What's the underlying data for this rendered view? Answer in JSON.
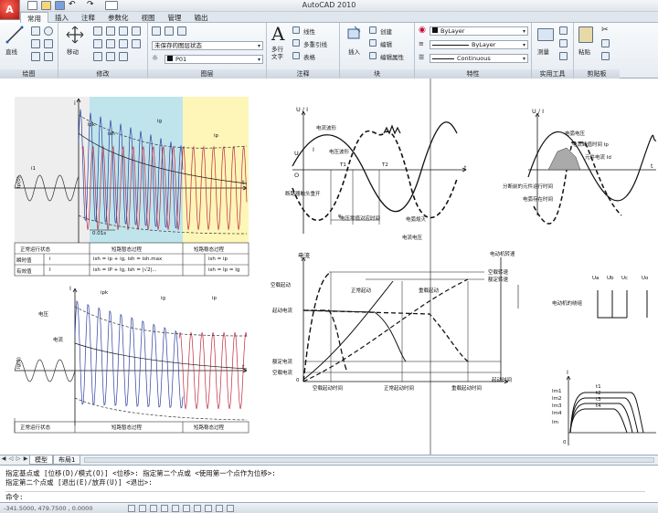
{
  "app": {
    "title": "AutoCAD 2010",
    "logo_letter": "A"
  },
  "quick_access": {
    "icons": [
      "new-file-icon",
      "open-folder-icon",
      "save-icon",
      "undo-icon",
      "redo-icon",
      "plot-icon"
    ]
  },
  "tabs": [
    "常用",
    "插入",
    "注释",
    "参数化",
    "视图",
    "管理",
    "输出"
  ],
  "ribbon": {
    "draw": {
      "title": "绘图",
      "line_label": "直线"
    },
    "modify": {
      "title": "修改",
      "move_label": "移动"
    },
    "layers": {
      "title": "图层",
      "layer_state": "未保存的图层状态",
      "current_layer": "P01"
    },
    "annotation": {
      "title": "注释",
      "text_label": "多行\n文字",
      "linear_label": "线性",
      "mleader_label": "多重引线",
      "table_label": "表格"
    },
    "block": {
      "title": "块",
      "insert_label": "插入",
      "create_label": "创建",
      "edit_label": "编辑",
      "edit_attr_label": "编辑属性"
    },
    "properties": {
      "title": "特性",
      "color": "ByLayer",
      "linetype": "ByLayer",
      "lineweight": "Continuous"
    },
    "utilities": {
      "title": "实用工具",
      "measure_label": "测量"
    },
    "clipboard": {
      "title": "剪贴板",
      "paste_label": "粘贴"
    }
  },
  "drawing": {
    "fig1": {
      "i_axis": "i",
      "t_axis": "t",
      "ipk": "ipk",
      "ish": "ish",
      "ig": "ig",
      "ip": "ip",
      "i1": "i1",
      "ip_pk": "Ip(0)",
      "table_rows": [
        [
          "正常运行状态",
          "",
          "短路暂态过程",
          "短路稳态过程"
        ],
        [
          "瞬时值",
          "i",
          "ish = ip + ig,  ish = ish.max",
          "ish = ip"
        ],
        [
          "有效值",
          "I",
          "ish = IP + Ig,  Ish = |√2|...",
          "ish = Ip = Ig"
        ]
      ],
      "time_label": "0.01s"
    },
    "fig2": {
      "u_axis": "U / I",
      "t_axis": "t",
      "U": "U",
      "I": "I",
      "O": "O",
      "T1": "T1",
      "T2": "T2",
      "phi": "φ",
      "labels": [
        "电流波形",
        "电压波形",
        "断路器触头重开",
        "电压零值对应时间",
        "电弧熄灭",
        "电流电压"
      ]
    },
    "fig3": {
      "u_axis": "U / I",
      "t_axis": "t",
      "labels": [
        "电弧电压",
        "电流峰值时间 Ip",
        "元件电流 Id",
        "分断前的元件运行时间",
        "电弧存在时间"
      ]
    },
    "fig4": {
      "i_axis": "I",
      "t_axis": "t",
      "ipk": "ipk",
      "ig": "ig",
      "ip": "ip",
      "voltage": "电压",
      "current": "电流",
      "ig0": "Ig(0)",
      "table": [
        "正常运行状态",
        "短路暂态过程",
        "短路稳态过程"
      ]
    },
    "fig5": {
      "y_title": "电流",
      "speed_title": "电动机转速",
      "curves": [
        "空载转速",
        "额定转速",
        "空载起动",
        "正常起动",
        "重载起动",
        "起动电流",
        "额定电流",
        "空载电流"
      ],
      "x_labels": [
        "空载起动时间",
        "正常起动时间",
        "重载起动时间"
      ],
      "x_axis": "起动时间",
      "origin": "0"
    },
    "fig6": {
      "phases": [
        "Ua",
        "Ub",
        "Uc",
        "Uo"
      ],
      "label": "电动机的绕组"
    },
    "fig7": {
      "y_axis": "I",
      "y_levels": [
        "Im1",
        "Im2",
        "Im3",
        "Im4",
        "Im"
      ],
      "curves": [
        "t1",
        "t2",
        "t3",
        "t4"
      ],
      "origin": "0"
    }
  },
  "layout_tabs": [
    "模型",
    "布局1"
  ],
  "command": {
    "history": [
      "指定基点或 [位移(D)/模式(O)] <位移>: 指定第二个点或 <使用第一个点作为位移>:",
      "指定第二个点或 [退出(E)/放弃(U)] <退出>:"
    ],
    "prompt": "命令:"
  },
  "status": {
    "coords": "-341.5000,  479.7500 , 0.0000"
  }
}
